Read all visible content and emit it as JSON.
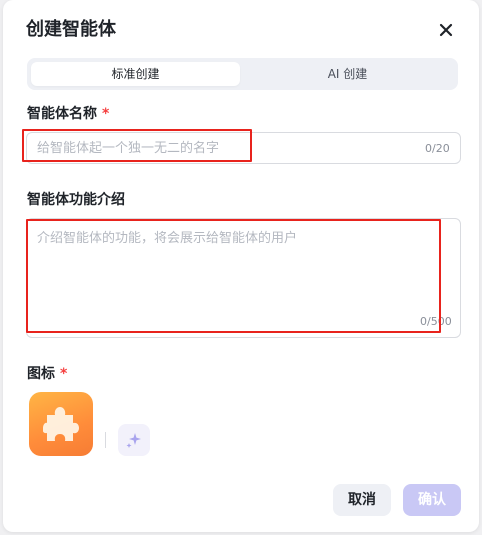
{
  "dialog": {
    "title": "创建智能体",
    "close_icon": "close-icon"
  },
  "tabs": [
    {
      "label": "标准创建",
      "active": true
    },
    {
      "label": "AI 创建",
      "active": false
    }
  ],
  "name_field": {
    "label": "智能体名称",
    "required_mark": "*",
    "placeholder": "给智能体起一个独一无二的名字",
    "value": "",
    "counter": "0/20"
  },
  "desc_field": {
    "label": "智能体功能介绍",
    "placeholder": "介绍智能体的功能，将会展示给智能体的用户",
    "value": "",
    "counter": "0/500"
  },
  "icon_section": {
    "label": "图标",
    "required_mark": "*",
    "current_icon": "puzzle-icon",
    "generate_icon": "sparkle-icon"
  },
  "footer": {
    "cancel_label": "取消",
    "confirm_label": "确认"
  },
  "colors": {
    "accent": "#c9c8f5",
    "required": "#f53f3f",
    "highlight": "#e8231d",
    "icon_gradient_start": "#ffb545",
    "icon_gradient_end": "#f67c34"
  }
}
